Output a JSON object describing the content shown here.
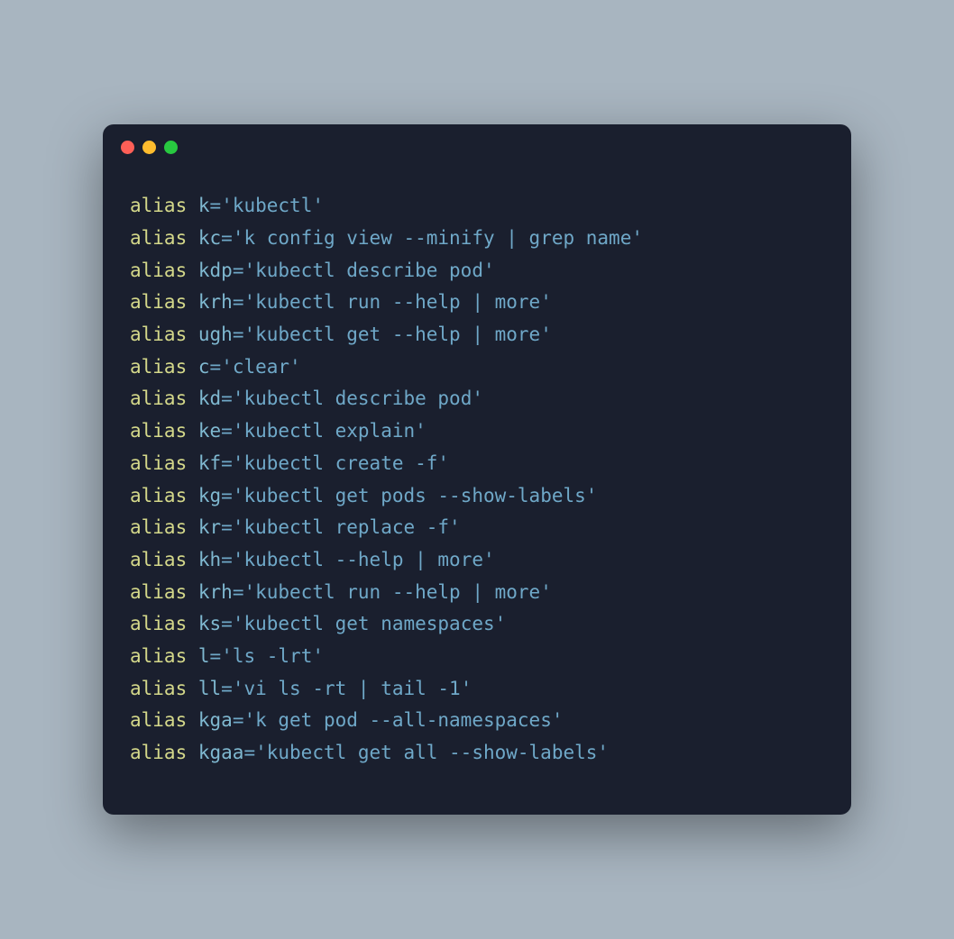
{
  "aliases": [
    {
      "keyword": "alias",
      "name": "k",
      "value": "'kubectl'"
    },
    {
      "keyword": "alias",
      "name": "kc",
      "value": "'k config view --minify | grep name'"
    },
    {
      "keyword": "alias",
      "name": "kdp",
      "value": "'kubectl describe pod'"
    },
    {
      "keyword": "alias",
      "name": "krh",
      "value": "'kubectl run --help | more'"
    },
    {
      "keyword": "alias",
      "name": "ugh",
      "value": "'kubectl get --help | more'"
    },
    {
      "keyword": "alias",
      "name": "c",
      "value": "'clear'"
    },
    {
      "keyword": "alias",
      "name": "kd",
      "value": "'kubectl describe pod'"
    },
    {
      "keyword": "alias",
      "name": "ke",
      "value": "'kubectl explain'"
    },
    {
      "keyword": "alias",
      "name": "kf",
      "value": "'kubectl create -f'"
    },
    {
      "keyword": "alias",
      "name": "kg",
      "value": "'kubectl get pods --show-labels'"
    },
    {
      "keyword": "alias",
      "name": "kr",
      "value": "'kubectl replace -f'"
    },
    {
      "keyword": "alias",
      "name": "kh",
      "value": "'kubectl --help | more'"
    },
    {
      "keyword": "alias",
      "name": "krh",
      "value": "'kubectl run --help | more'"
    },
    {
      "keyword": "alias",
      "name": "ks",
      "value": "'kubectl get namespaces'"
    },
    {
      "keyword": "alias",
      "name": "l",
      "value": "'ls -lrt'"
    },
    {
      "keyword": "alias",
      "name": "ll",
      "value": "'vi ls -rt | tail -1'"
    },
    {
      "keyword": "alias",
      "name": "kga",
      "value": "'k get pod --all-namespaces'"
    },
    {
      "keyword": "alias",
      "name": "kgaa",
      "value": "'kubectl get all --show-labels'"
    }
  ]
}
